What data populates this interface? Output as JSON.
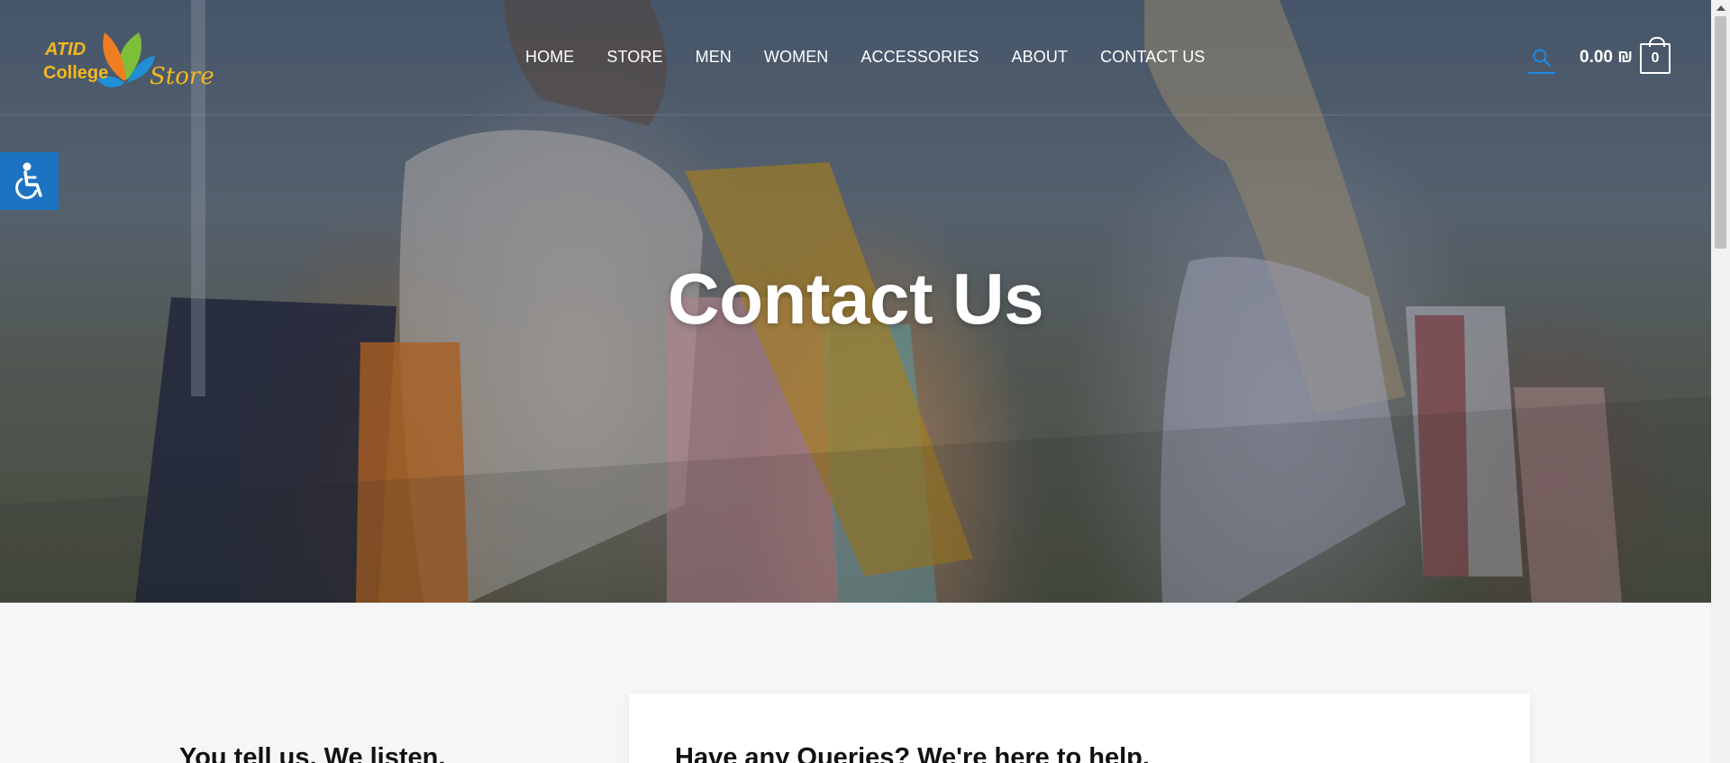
{
  "brand": {
    "line1": "ATID",
    "line2": "College",
    "line3": "Store"
  },
  "nav": {
    "items": [
      "HOME",
      "STORE",
      "MEN",
      "WOMEN",
      "ACCESSORIES",
      "ABOUT",
      "CONTACT US"
    ]
  },
  "cart": {
    "total": "0.00 ₪",
    "count": "0"
  },
  "hero": {
    "title": "Contact Us"
  },
  "sections": {
    "left_heading": "You tell us. We listen.",
    "card_heading": "Have any Queries? We're here to help."
  },
  "icons": {
    "search": "search-icon",
    "cart": "shopping-bag-icon",
    "accessibility": "accessibility-icon"
  },
  "colors": {
    "accent": "#1b73c1",
    "search_underline": "#1e88e5",
    "logo": "#f2b820"
  }
}
